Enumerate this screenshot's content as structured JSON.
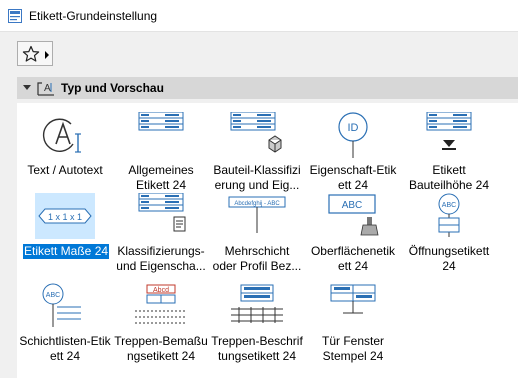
{
  "window": {
    "title": "Etikett-Grundeinstellung"
  },
  "toolbar": {
    "favorites_icon": "star-icon"
  },
  "section": {
    "title": "Typ und Vorschau",
    "icon": "label-preview-icon"
  },
  "tiles": [
    {
      "label": "Text / Autotext",
      "icon": "text-autotext-icon"
    },
    {
      "label": "Allgemeines\nEtikett 24",
      "icon": "general-label-icon"
    },
    {
      "label": "Bauteil-Klassifizi\nerung und Eig...",
      "icon": "element-classification-icon"
    },
    {
      "label": "Eigenschaft-Etik\nett 24",
      "icon": "property-label-icon",
      "badge": "ID"
    },
    {
      "label": "Etikett\nBauteilhöhe 24",
      "icon": "element-height-label-icon"
    },
    {
      "label": "Etikett Maße 24",
      "icon": "dimension-label-icon",
      "selected": true,
      "badge": "1 x 1 x 1"
    },
    {
      "label": "Klassifizierungs-\nund Eigenscha...",
      "icon": "classification-properties-icon"
    },
    {
      "label": "Mehrschicht\noder Profil Bez...",
      "icon": "composite-profile-icon",
      "badge": "Abcdefghij - ABC"
    },
    {
      "label": "Oberflächenetik\nett 24",
      "icon": "surface-label-icon",
      "badge": "ABC"
    },
    {
      "label": "Öffnungsetikett\n24",
      "icon": "opening-label-icon",
      "badge": "ABC"
    },
    {
      "label": "Schichtlisten-Etik\nett 24",
      "icon": "layer-list-label-icon",
      "badge": "ABC"
    },
    {
      "label": "Treppen-Bemaßu\nngsetikett 24",
      "icon": "stair-dimension-label-icon",
      "badge": "Abcd"
    },
    {
      "label": "Treppen-Beschrif\ntungsetikett 24",
      "icon": "stair-annotation-label-icon"
    },
    {
      "label": "Tür Fenster\nStempel 24",
      "icon": "door-window-stamp-icon"
    }
  ],
  "colors": {
    "selection": "#0078d7",
    "selection_light": "#cce8ff",
    "accent_blue": "#2a6fb4"
  }
}
